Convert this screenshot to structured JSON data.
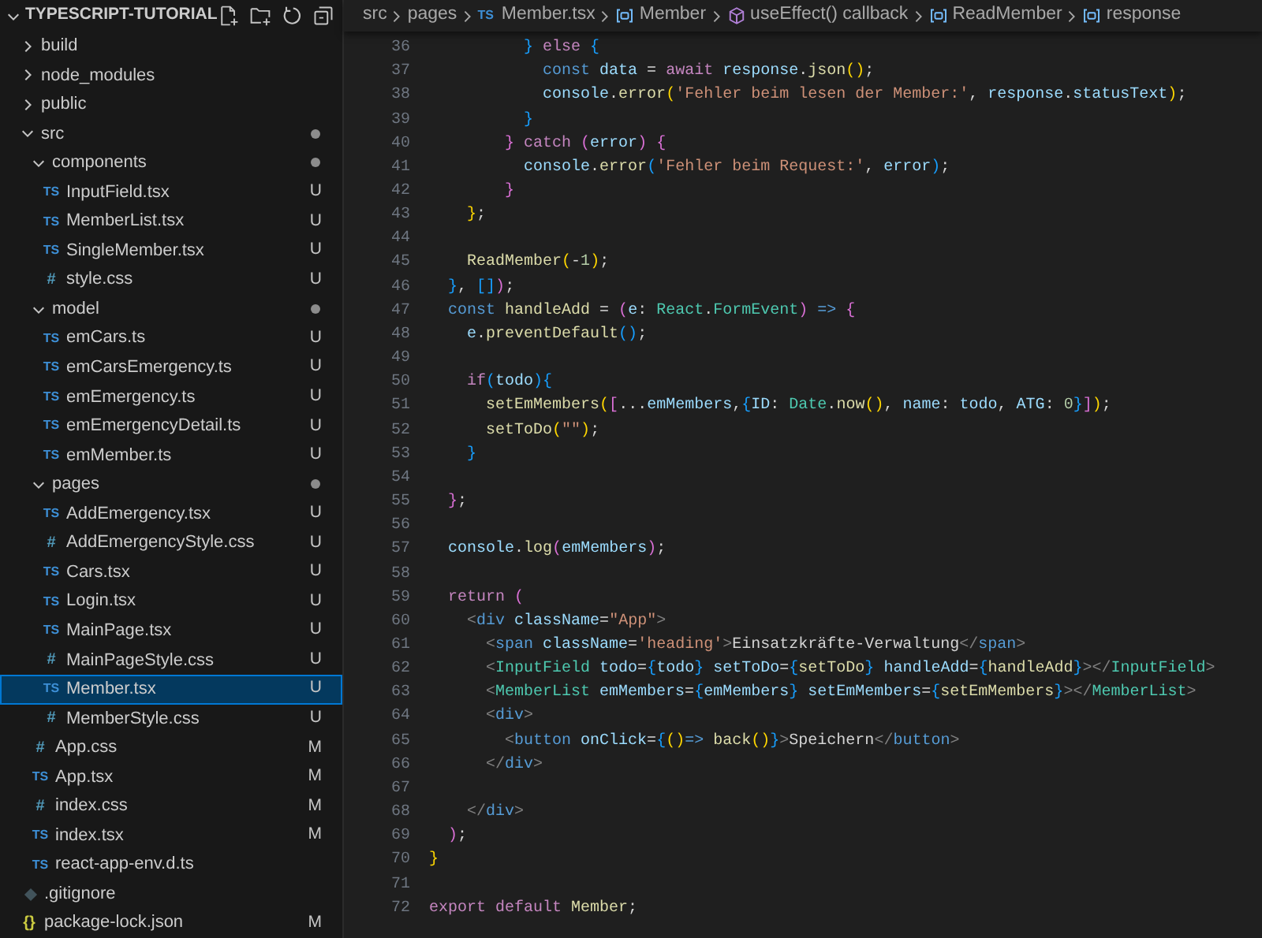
{
  "explorer": {
    "title": "TYPESCRIPT-TUTORIAL",
    "expanded": true,
    "items": [
      {
        "name": "build",
        "kind": "folder",
        "expanded": false,
        "selected": false
      },
      {
        "name": "node_modules",
        "kind": "folder",
        "expanded": false,
        "selected": false
      },
      {
        "name": "public",
        "kind": "folder",
        "expanded": false,
        "selected": false
      },
      {
        "name": "src",
        "kind": "folder",
        "expanded": true,
        "selected": false,
        "changes": true,
        "children": [
          {
            "name": "components",
            "kind": "folder",
            "expanded": true,
            "selected": false,
            "changes": true,
            "children": [
              {
                "name": "InputField.tsx",
                "kind": "ts",
                "icon": "TS",
                "selected": false,
                "status": "U"
              },
              {
                "name": "MemberList.tsx",
                "kind": "ts",
                "icon": "TS",
                "selected": false,
                "status": "U"
              },
              {
                "name": "SingleMember.tsx",
                "kind": "ts",
                "icon": "TS",
                "selected": false,
                "status": "U"
              },
              {
                "name": "style.css",
                "kind": "css",
                "icon": "#",
                "selected": false,
                "status": "U"
              }
            ]
          },
          {
            "name": "model",
            "kind": "folder",
            "expanded": true,
            "selected": false,
            "changes": true,
            "children": [
              {
                "name": "emCars.ts",
                "kind": "ts",
                "icon": "TS",
                "selected": false,
                "status": "U"
              },
              {
                "name": "emCarsEmergency.ts",
                "kind": "ts",
                "icon": "TS",
                "selected": false,
                "status": "U"
              },
              {
                "name": "emEmergency.ts",
                "kind": "ts",
                "icon": "TS",
                "selected": false,
                "status": "U"
              },
              {
                "name": "emEmergencyDetail.ts",
                "kind": "ts",
                "icon": "TS",
                "selected": false,
                "status": "U"
              },
              {
                "name": "emMember.ts",
                "kind": "ts",
                "icon": "TS",
                "selected": false,
                "status": "U"
              }
            ]
          },
          {
            "name": "pages",
            "kind": "folder",
            "expanded": true,
            "selected": false,
            "changes": true,
            "children": [
              {
                "name": "AddEmergency.tsx",
                "kind": "ts",
                "icon": "TS",
                "selected": false,
                "status": "U"
              },
              {
                "name": "AddEmergencyStyle.css",
                "kind": "css",
                "icon": "#",
                "selected": false,
                "status": "U"
              },
              {
                "name": "Cars.tsx",
                "kind": "ts",
                "icon": "TS",
                "selected": false,
                "status": "U"
              },
              {
                "name": "Login.tsx",
                "kind": "ts",
                "icon": "TS",
                "selected": false,
                "status": "U"
              },
              {
                "name": "MainPage.tsx",
                "kind": "ts",
                "icon": "TS",
                "selected": false,
                "status": "U"
              },
              {
                "name": "MainPageStyle.css",
                "kind": "css",
                "icon": "#",
                "selected": false,
                "status": "U"
              },
              {
                "name": "Member.tsx",
                "kind": "ts",
                "icon": "TS",
                "selected": true,
                "status": "U"
              },
              {
                "name": "MemberStyle.css",
                "kind": "css",
                "icon": "#",
                "selected": false,
                "status": "U"
              }
            ]
          },
          {
            "name": "App.css",
            "kind": "css",
            "icon": "#",
            "selected": false,
            "status": "M"
          },
          {
            "name": "App.tsx",
            "kind": "ts",
            "icon": "TS",
            "selected": false,
            "status": "M"
          },
          {
            "name": "index.css",
            "kind": "css",
            "icon": "#",
            "selected": false,
            "status": "M"
          },
          {
            "name": "index.tsx",
            "kind": "ts",
            "icon": "TS",
            "selected": false,
            "status": "M"
          },
          {
            "name": "react-app-env.d.ts",
            "kind": "ts",
            "icon": "TS",
            "selected": false
          }
        ]
      },
      {
        "name": ".gitignore",
        "kind": "git",
        "selected": false
      },
      {
        "name": "package-lock.json",
        "kind": "json",
        "icon": "{}",
        "selected": false,
        "status": "M"
      }
    ]
  },
  "breadcrumb": [
    {
      "label": "src",
      "kind": "folder"
    },
    {
      "label": "pages",
      "kind": "folder"
    },
    {
      "label": "Member.tsx",
      "kind": "ts",
      "icon": "TS"
    },
    {
      "label": "Member",
      "kind": "variable"
    },
    {
      "label": "useEffect() callback",
      "kind": "method"
    },
    {
      "label": "ReadMember",
      "kind": "variable"
    },
    {
      "label": "response",
      "kind": "variable"
    }
  ],
  "editor": {
    "lines": [
      {
        "number": "36",
        "tokens": [
          {
            "kind": "b3",
            "text": "          }"
          },
          {
            "kind": "k",
            "text": " else"
          },
          {
            "kind": "b3",
            "text": " {"
          }
        ]
      },
      {
        "number": "37",
        "tokens": [
          {
            "kind": "s",
            "text": "            const"
          },
          {
            "kind": "v",
            "text": " data"
          },
          {
            "kind": "p",
            "text": " = "
          },
          {
            "kind": "k",
            "text": "await"
          },
          {
            "kind": "v",
            "text": " response"
          },
          {
            "kind": "p",
            "text": "."
          },
          {
            "kind": "f",
            "text": "json"
          },
          {
            "kind": "b1",
            "text": "()"
          },
          {
            "kind": "p",
            "text": ";"
          }
        ]
      },
      {
        "number": "38",
        "tokens": [
          {
            "kind": "v",
            "text": "            console"
          },
          {
            "kind": "p",
            "text": "."
          },
          {
            "kind": "f",
            "text": "error"
          },
          {
            "kind": "b1",
            "text": "("
          },
          {
            "kind": "str",
            "text": "'Fehler beim lesen der Member:'"
          },
          {
            "kind": "p",
            "text": ","
          },
          {
            "kind": "v",
            "text": " response"
          },
          {
            "kind": "p",
            "text": "."
          },
          {
            "kind": "v",
            "text": "statusText"
          },
          {
            "kind": "b1",
            "text": ")"
          },
          {
            "kind": "p",
            "text": ";"
          }
        ]
      },
      {
        "number": "39",
        "tokens": [
          {
            "kind": "b3",
            "text": "          }"
          }
        ]
      },
      {
        "number": "40",
        "tokens": [
          {
            "kind": "b2",
            "text": "        }"
          },
          {
            "kind": "k",
            "text": " catch"
          },
          {
            "kind": "b2",
            "text": " ("
          },
          {
            "kind": "v",
            "text": "error"
          },
          {
            "kind": "b2",
            "text": ")"
          },
          {
            "kind": "b2",
            "text": " {"
          }
        ]
      },
      {
        "number": "41",
        "tokens": [
          {
            "kind": "v",
            "text": "          console"
          },
          {
            "kind": "p",
            "text": "."
          },
          {
            "kind": "f",
            "text": "error"
          },
          {
            "kind": "b3",
            "text": "("
          },
          {
            "kind": "str",
            "text": "'Fehler beim Request:'"
          },
          {
            "kind": "p",
            "text": ","
          },
          {
            "kind": "v",
            "text": " error"
          },
          {
            "kind": "b3",
            "text": ")"
          },
          {
            "kind": "p",
            "text": ";"
          }
        ]
      },
      {
        "number": "42",
        "tokens": [
          {
            "kind": "b2",
            "text": "        }"
          }
        ]
      },
      {
        "number": "43",
        "tokens": [
          {
            "kind": "b1",
            "text": "    }"
          },
          {
            "kind": "p",
            "text": ";"
          }
        ]
      },
      {
        "number": "44"
      },
      {
        "number": "45",
        "tokens": [
          {
            "kind": "f",
            "text": "    ReadMember"
          },
          {
            "kind": "b1",
            "text": "("
          },
          {
            "kind": "p",
            "text": "-"
          },
          {
            "kind": "n",
            "text": "1"
          },
          {
            "kind": "b1",
            "text": ")"
          },
          {
            "kind": "p",
            "text": ";"
          }
        ]
      },
      {
        "number": "46",
        "tokens": [
          {
            "kind": "b3",
            "text": "  }"
          },
          {
            "kind": "p",
            "text": ","
          },
          {
            "kind": "b3",
            "text": " []"
          },
          {
            "kind": "b2",
            "text": ")"
          },
          {
            "kind": "p",
            "text": ";"
          }
        ]
      },
      {
        "number": "47",
        "tokens": [
          {
            "kind": "s",
            "text": "  const"
          },
          {
            "kind": "f",
            "text": " handleAdd"
          },
          {
            "kind": "p",
            "text": " = "
          },
          {
            "kind": "b2",
            "text": "("
          },
          {
            "kind": "v",
            "text": "e"
          },
          {
            "kind": "p",
            "text": ":"
          },
          {
            "kind": "t",
            "text": " React"
          },
          {
            "kind": "p",
            "text": "."
          },
          {
            "kind": "t",
            "text": "FormEvent"
          },
          {
            "kind": "b2",
            "text": ")"
          },
          {
            "kind": "s",
            "text": " =>"
          },
          {
            "kind": "b2",
            "text": " {"
          }
        ]
      },
      {
        "number": "48",
        "tokens": [
          {
            "kind": "v",
            "text": "    e"
          },
          {
            "kind": "p",
            "text": "."
          },
          {
            "kind": "f",
            "text": "preventDefault"
          },
          {
            "kind": "b3",
            "text": "()"
          },
          {
            "kind": "p",
            "text": ";"
          }
        ]
      },
      {
        "number": "49"
      },
      {
        "number": "50",
        "tokens": [
          {
            "kind": "k",
            "text": "    if"
          },
          {
            "kind": "b3",
            "text": "("
          },
          {
            "kind": "v",
            "text": "todo"
          },
          {
            "kind": "b3",
            "text": "){"
          }
        ]
      },
      {
        "number": "51",
        "tokens": [
          {
            "kind": "f",
            "text": "      setEmMembers"
          },
          {
            "kind": "b1",
            "text": "("
          },
          {
            "kind": "b2",
            "text": "["
          },
          {
            "kind": "p",
            "text": "..."
          },
          {
            "kind": "v",
            "text": "emMembers"
          },
          {
            "kind": "p",
            "text": ","
          },
          {
            "kind": "b3",
            "text": "{"
          },
          {
            "kind": "v",
            "text": "ID"
          },
          {
            "kind": "p",
            "text": ":"
          },
          {
            "kind": "t",
            "text": " Date"
          },
          {
            "kind": "p",
            "text": "."
          },
          {
            "kind": "f",
            "text": "now"
          },
          {
            "kind": "b1",
            "text": "()"
          },
          {
            "kind": "p",
            "text": ","
          },
          {
            "kind": "v",
            "text": " name"
          },
          {
            "kind": "p",
            "text": ":"
          },
          {
            "kind": "v",
            "text": " todo"
          },
          {
            "kind": "p",
            "text": ","
          },
          {
            "kind": "v",
            "text": " ATG"
          },
          {
            "kind": "p",
            "text": ":"
          },
          {
            "kind": "n",
            "text": " 0"
          },
          {
            "kind": "b3",
            "text": "}"
          },
          {
            "kind": "b2",
            "text": "]"
          },
          {
            "kind": "b1",
            "text": ")"
          },
          {
            "kind": "p",
            "text": ";"
          }
        ]
      },
      {
        "number": "52",
        "tokens": [
          {
            "kind": "f",
            "text": "      setToDo"
          },
          {
            "kind": "b1",
            "text": "("
          },
          {
            "kind": "str",
            "text": "\"\""
          },
          {
            "kind": "b1",
            "text": ")"
          },
          {
            "kind": "p",
            "text": ";"
          }
        ]
      },
      {
        "number": "53",
        "tokens": [
          {
            "kind": "b3",
            "text": "    }"
          }
        ]
      },
      {
        "number": "54"
      },
      {
        "number": "55",
        "tokens": [
          {
            "kind": "b2",
            "text": "  }"
          },
          {
            "kind": "p",
            "text": ";"
          }
        ]
      },
      {
        "number": "56"
      },
      {
        "number": "57",
        "tokens": [
          {
            "kind": "v",
            "text": "  console"
          },
          {
            "kind": "p",
            "text": "."
          },
          {
            "kind": "f",
            "text": "log"
          },
          {
            "kind": "b2",
            "text": "("
          },
          {
            "kind": "v",
            "text": "emMembers"
          },
          {
            "kind": "b2",
            "text": ")"
          },
          {
            "kind": "p",
            "text": ";"
          }
        ]
      },
      {
        "number": "58"
      },
      {
        "number": "59",
        "tokens": [
          {
            "kind": "k",
            "text": "  return"
          },
          {
            "kind": "b2",
            "text": " ("
          }
        ]
      },
      {
        "number": "60",
        "tokens": [
          {
            "kind": "g",
            "text": "    <"
          },
          {
            "kind": "s",
            "text": "div"
          },
          {
            "kind": "v",
            "text": " className"
          },
          {
            "kind": "p",
            "text": "="
          },
          {
            "kind": "str",
            "text": "\"App\""
          },
          {
            "kind": "g",
            "text": ">"
          }
        ]
      },
      {
        "number": "61",
        "tokens": [
          {
            "kind": "g",
            "text": "      <"
          },
          {
            "kind": "s",
            "text": "span"
          },
          {
            "kind": "v",
            "text": " className"
          },
          {
            "kind": "p",
            "text": "="
          },
          {
            "kind": "str",
            "text": "'heading'"
          },
          {
            "kind": "g",
            "text": ">"
          },
          {
            "kind": "p",
            "text": "Einsatzkräfte-Verwaltung"
          },
          {
            "kind": "g",
            "text": "</"
          },
          {
            "kind": "s",
            "text": "span"
          },
          {
            "kind": "g",
            "text": ">"
          }
        ]
      },
      {
        "number": "62",
        "tokens": [
          {
            "kind": "g",
            "text": "      <"
          },
          {
            "kind": "t",
            "text": "InputField"
          },
          {
            "kind": "v",
            "text": " todo"
          },
          {
            "kind": "p",
            "text": "="
          },
          {
            "kind": "b3",
            "text": "{"
          },
          {
            "kind": "v",
            "text": "todo"
          },
          {
            "kind": "b3",
            "text": "}"
          },
          {
            "kind": "v",
            "text": " setToDo"
          },
          {
            "kind": "p",
            "text": "="
          },
          {
            "kind": "b3",
            "text": "{"
          },
          {
            "kind": "f",
            "text": "setToDo"
          },
          {
            "kind": "b3",
            "text": "}"
          },
          {
            "kind": "v",
            "text": " handleAdd"
          },
          {
            "kind": "p",
            "text": "="
          },
          {
            "kind": "b3",
            "text": "{"
          },
          {
            "kind": "f",
            "text": "handleAdd"
          },
          {
            "kind": "b3",
            "text": "}"
          },
          {
            "kind": "g",
            "text": "></"
          },
          {
            "kind": "t",
            "text": "InputField"
          },
          {
            "kind": "g",
            "text": ">"
          }
        ]
      },
      {
        "number": "63",
        "tokens": [
          {
            "kind": "g",
            "text": "      <"
          },
          {
            "kind": "t",
            "text": "MemberList"
          },
          {
            "kind": "v",
            "text": " emMembers"
          },
          {
            "kind": "p",
            "text": "="
          },
          {
            "kind": "b3",
            "text": "{"
          },
          {
            "kind": "v",
            "text": "emMembers"
          },
          {
            "kind": "b3",
            "text": "}"
          },
          {
            "kind": "v",
            "text": " setEmMembers"
          },
          {
            "kind": "p",
            "text": "="
          },
          {
            "kind": "b3",
            "text": "{"
          },
          {
            "kind": "f",
            "text": "setEmMembers"
          },
          {
            "kind": "b3",
            "text": "}"
          },
          {
            "kind": "g",
            "text": "></"
          },
          {
            "kind": "t",
            "text": "MemberList"
          },
          {
            "kind": "g",
            "text": ">"
          }
        ]
      },
      {
        "number": "64",
        "tokens": [
          {
            "kind": "g",
            "text": "      <"
          },
          {
            "kind": "s",
            "text": "div"
          },
          {
            "kind": "g",
            "text": ">"
          }
        ]
      },
      {
        "number": "65",
        "tokens": [
          {
            "kind": "g",
            "text": "        <"
          },
          {
            "kind": "s",
            "text": "button"
          },
          {
            "kind": "v",
            "text": " onClick"
          },
          {
            "kind": "p",
            "text": "="
          },
          {
            "kind": "b3",
            "text": "{"
          },
          {
            "kind": "b1",
            "text": "()"
          },
          {
            "kind": "s",
            "text": "=>"
          },
          {
            "kind": "f",
            "text": " back"
          },
          {
            "kind": "b1",
            "text": "()"
          },
          {
            "kind": "b3",
            "text": "}"
          },
          {
            "kind": "g",
            "text": ">"
          },
          {
            "kind": "p",
            "text": "Speichern"
          },
          {
            "kind": "g",
            "text": "</"
          },
          {
            "kind": "s",
            "text": "button"
          },
          {
            "kind": "g",
            "text": ">"
          }
        ]
      },
      {
        "number": "66",
        "tokens": [
          {
            "kind": "g",
            "text": "      </"
          },
          {
            "kind": "s",
            "text": "div"
          },
          {
            "kind": "g",
            "text": ">"
          }
        ]
      },
      {
        "number": "67"
      },
      {
        "number": "68",
        "tokens": [
          {
            "kind": "g",
            "text": "    </"
          },
          {
            "kind": "s",
            "text": "div"
          },
          {
            "kind": "g",
            "text": ">"
          }
        ]
      },
      {
        "number": "69",
        "tokens": [
          {
            "kind": "b2",
            "text": "  )"
          },
          {
            "kind": "p",
            "text": ";"
          }
        ]
      },
      {
        "number": "70",
        "tokens": [
          {
            "kind": "b1",
            "text": "}"
          }
        ]
      },
      {
        "number": "71"
      },
      {
        "number": "72",
        "tokens": [
          {
            "kind": "k",
            "text": "export"
          },
          {
            "kind": "k",
            "text": " default"
          },
          {
            "kind": "f",
            "text": " Member"
          },
          {
            "kind": "p",
            "text": ";"
          }
        ]
      }
    ]
  }
}
